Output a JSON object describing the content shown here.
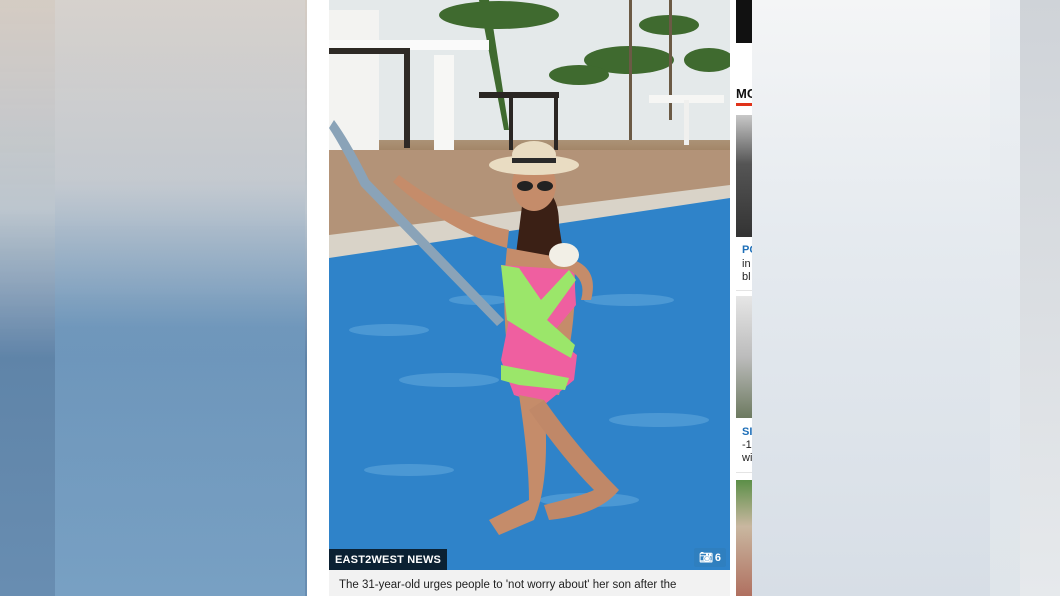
{
  "photo": {
    "credit": "EAST2WEST NEWS",
    "gallery_count": "6",
    "camera_icon": "camera-icon"
  },
  "caption": {
    "text": "The 31-year-old urges people to 'not worry about' her son after the"
  },
  "sidebar": {
    "heading": "MO",
    "items": [
      {
        "tag": "PO",
        "line1": "in",
        "line2": "bl"
      },
      {
        "tag": "SI",
        "line1": "-1",
        "line2": "wi"
      }
    ]
  }
}
